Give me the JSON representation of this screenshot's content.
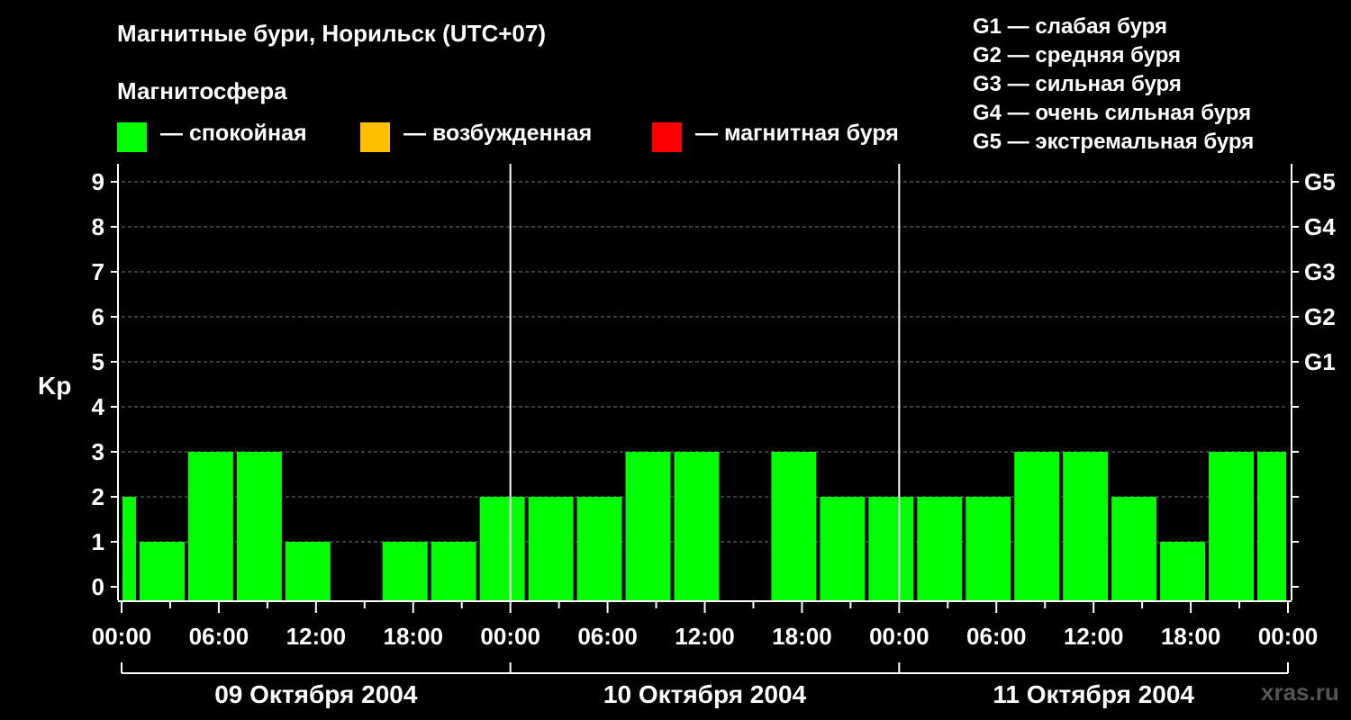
{
  "title": "Магнитные бури, Норильск (UTC+07)",
  "legend": {
    "title": "Магнитосфера",
    "items": [
      {
        "label": "— спокойная",
        "color": "#00ff00"
      },
      {
        "label": "— возбужденная",
        "color": "#ffbf00"
      },
      {
        "label": "— магнитная буря",
        "color": "#ff0000"
      }
    ]
  },
  "storm_levels": [
    "G1 — слабая буря",
    "G2 — средняя буря",
    "G3 — сильная буря",
    "G4 — очень сильная буря",
    "G5 — экстремальная буря"
  ],
  "watermark": "xras.ru",
  "chart_data": {
    "type": "bar",
    "title": "Магнитные бури, Норильск (UTC+07)",
    "ylabel": "Kp",
    "ylim": [
      0,
      9
    ],
    "yticks": [
      "0",
      "1",
      "2",
      "3",
      "4",
      "5",
      "6",
      "7",
      "8",
      "9"
    ],
    "right_axis_labels": [
      {
        "kp": 5,
        "label": "G1"
      },
      {
        "kp": 6,
        "label": "G2"
      },
      {
        "kp": 7,
        "label": "G3"
      },
      {
        "kp": 8,
        "label": "G4"
      },
      {
        "kp": 9,
        "label": "G5"
      }
    ],
    "xticks": [
      "00:00",
      "06:00",
      "12:00",
      "18:00",
      "00:00",
      "06:00",
      "12:00",
      "18:00",
      "00:00",
      "06:00",
      "12:00",
      "18:00",
      "00:00"
    ],
    "days": [
      "09 Октября 2004",
      "10 Октября 2004",
      "11 Октября 2004"
    ],
    "x_start": "2004-10-09 00:00",
    "interval_hours": 3,
    "first_interval_start": "2004-10-08 22:00",
    "grid": true,
    "series": [
      {
        "color": "#00ff00",
        "values": [
          2,
          1,
          3,
          3,
          1,
          0,
          1,
          1,
          2,
          2,
          2,
          3,
          3,
          0,
          3,
          2,
          2,
          2,
          2,
          3,
          3,
          2,
          1,
          3,
          3
        ]
      }
    ]
  }
}
